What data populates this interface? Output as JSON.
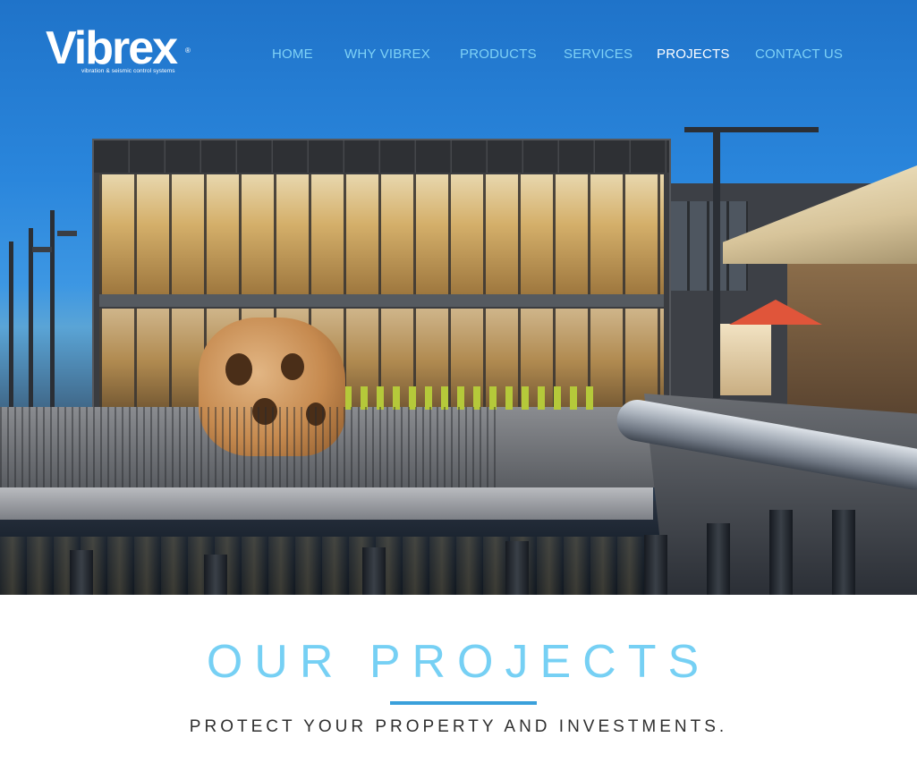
{
  "brand": {
    "logo_word": "Vibrex",
    "logo_tagline": "vibration & seismic control systems",
    "registered_mark": "®"
  },
  "nav": {
    "items": [
      {
        "label": "HOME",
        "active": false
      },
      {
        "label": "WHY VIBREX",
        "active": false
      },
      {
        "label": "PRODUCTS",
        "active": false
      },
      {
        "label": "SERVICES",
        "active": false
      },
      {
        "label": "PROJECTS",
        "active": true
      },
      {
        "label": "CONTACT US",
        "active": false
      }
    ]
  },
  "section": {
    "title": "OUR PROJECTS",
    "subtitle": "PROTECT YOUR PROPERTY AND INVESTMENTS."
  },
  "colors": {
    "nav_link": "#7fd2f6",
    "nav_active": "#ffffff",
    "title": "#76d0f4",
    "rule": "#3aa0db",
    "subtitle": "#2f2f2f"
  }
}
